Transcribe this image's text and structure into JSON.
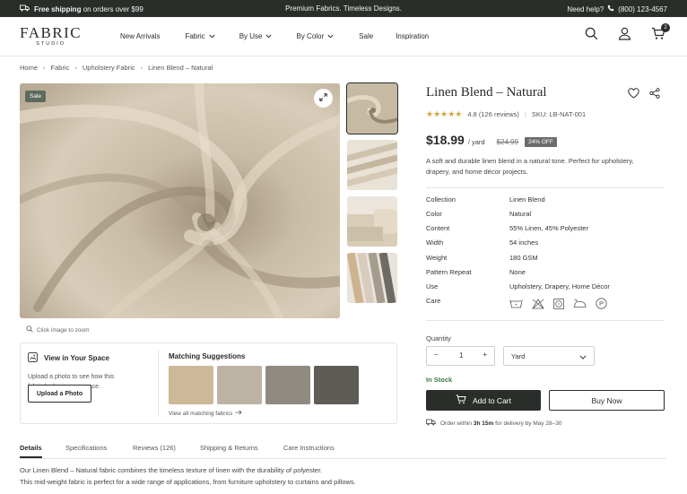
{
  "topbar": {
    "shipping_bold": "Free shipping",
    "shipping_rest": "on orders over $99",
    "tagline": "Premium Fabrics. Timeless Designs.",
    "help_label": "Need help?",
    "phone": "(800) 123-4567"
  },
  "brand": {
    "name": "FABRIC",
    "sub": "STUDIO"
  },
  "nav": [
    {
      "label": "New Arrivals",
      "has_menu": false
    },
    {
      "label": "Fabric",
      "has_menu": true
    },
    {
      "label": "By Use",
      "has_menu": true
    },
    {
      "label": "By Color",
      "has_menu": true
    },
    {
      "label": "Sale",
      "has_menu": false
    },
    {
      "label": "Inspiration",
      "has_menu": false
    }
  ],
  "header_icons": [
    "search-icon",
    "user-icon",
    "cart-icon"
  ],
  "cart_count": "2",
  "breadcrumb": [
    "Home",
    "Fabric",
    "Upholstery Fabric",
    "Linen Blend – Natural"
  ],
  "gallery": {
    "sale_label": "Sale",
    "zoom_hint": "Click image to zoom",
    "main_color": "#c9bda9"
  },
  "space": {
    "title": "View in Your Space",
    "desc": "Upload a photo to see how this fabric looks in your space.",
    "upload_label": "Upload a Photo"
  },
  "suggestions": {
    "title": "Matching Suggestions",
    "swatch_colors": [
      "#cdb89a",
      "#bdb3a5",
      "#8f8a80",
      "#5f5b57"
    ],
    "link": "View all matching fabrics"
  },
  "tabs": [
    {
      "label": "Details",
      "active": true
    },
    {
      "label": "Specifications",
      "active": false
    },
    {
      "label": "Reviews (126)",
      "active": false
    },
    {
      "label": "Shipping & Returns",
      "active": false
    },
    {
      "label": "Care Instructions",
      "active": false
    }
  ],
  "description": {
    "line1": "Our Linen Blend – Natural fabric combines the timeless texture of linen with the durability of polyester.",
    "line2": "This mid-weight fabric is perfect for a wide range of applications, from furniture upholstery to curtains and pillows."
  },
  "product": {
    "title": "Linen Blend – Natural",
    "stars": "★★★★★",
    "rating": "4.8 (126 reviews)",
    "sku": "SKU: LB-NAT-001",
    "price": "$18.99",
    "per": "/ yard",
    "old_price": "$24.99",
    "discount": "24% OFF",
    "short_desc": "A soft and durable linen blend in a natural tone. Perfect for upholstery, drapery, and home décor projects."
  },
  "specs": [
    {
      "key": "Collection",
      "value": "Linen Blend"
    },
    {
      "key": "Color",
      "value": "Natural"
    },
    {
      "key": "Content",
      "value": "55% Linen, 45% Polyester"
    },
    {
      "key": "Width",
      "value": "54 inches"
    },
    {
      "key": "Weight",
      "value": "180 GSM"
    },
    {
      "key": "Pattern Repeat",
      "value": "None"
    },
    {
      "key": "Use",
      "value": "Upholstery, Drapery, Home Décor"
    },
    {
      "key": "Care",
      "value": ""
    }
  ],
  "care_icons": [
    "wash-30-icon",
    "no-bleach-icon",
    "tumble-dry-icon",
    "iron-icon",
    "dry-clean-p-icon"
  ],
  "purchase": {
    "qty_label": "Quantity",
    "qty_minus": "−",
    "qty": "1",
    "qty_plus": "+",
    "unit": "Yard",
    "stock": "In Stock",
    "add_to_cart": "Add to Cart",
    "buy_now": "Buy Now",
    "delivery_pre": "Order within",
    "delivery_time": "3h 15m",
    "delivery_post": "for delivery by May 28–30"
  },
  "colors": {
    "dark": "#2a2e2a",
    "accent_green": "#3e7a4a",
    "star": "#d6a43b",
    "sale_badge": "#5c6b5e"
  }
}
